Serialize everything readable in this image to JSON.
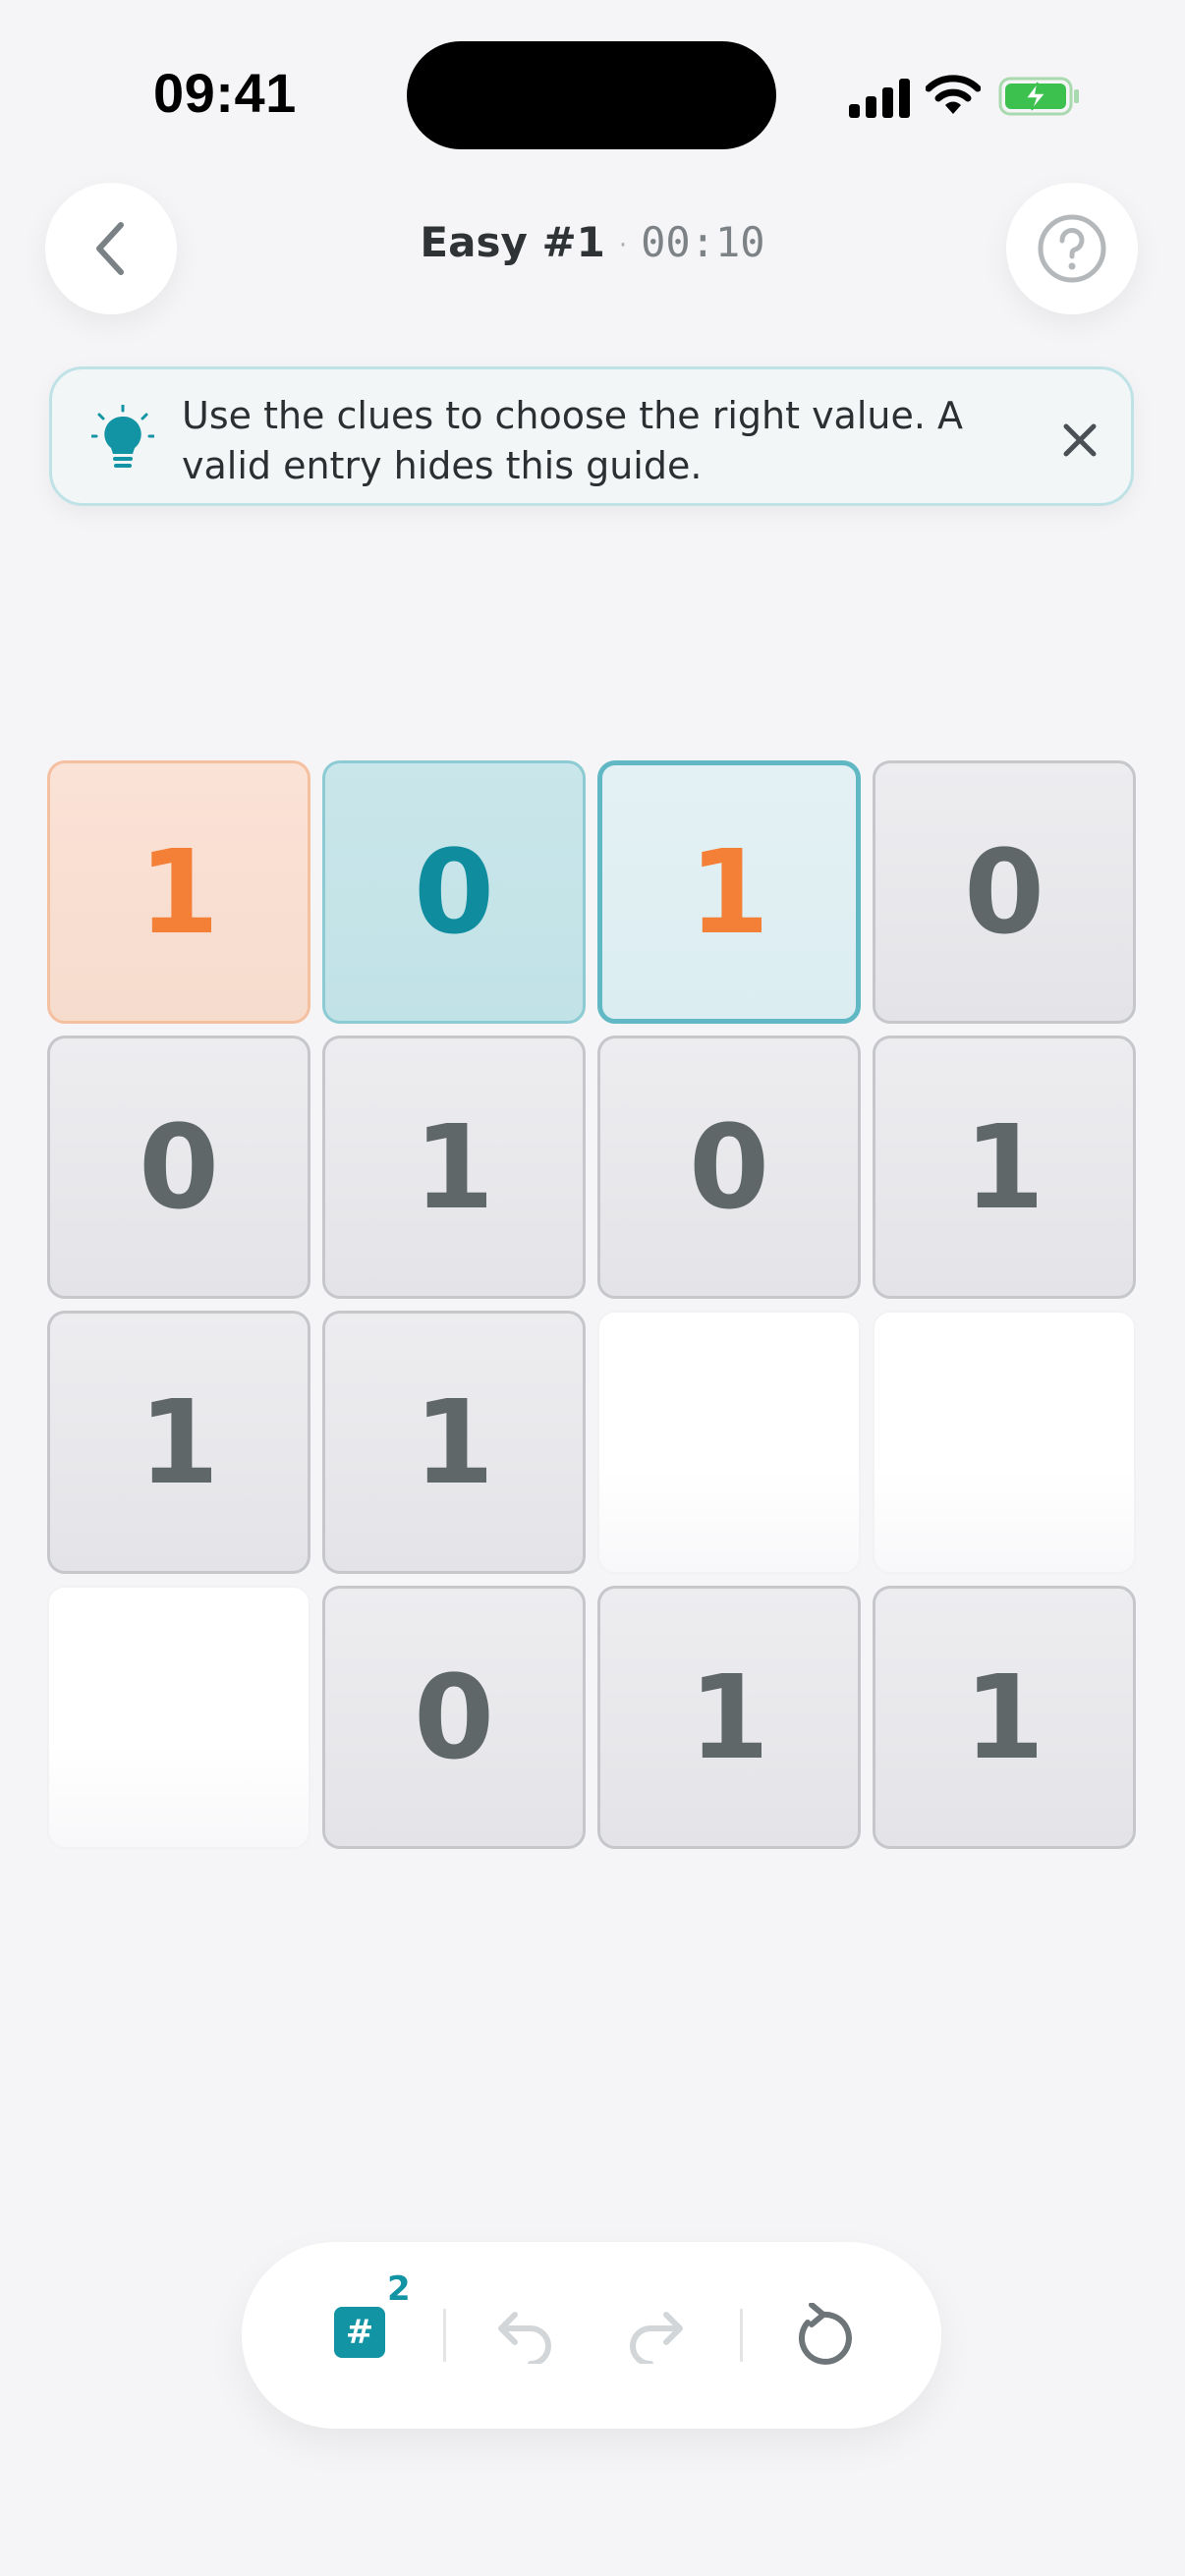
{
  "status_bar": {
    "time": "09:41",
    "icons": [
      "signal-icon",
      "wifi-icon",
      "battery-charging-icon"
    ]
  },
  "header": {
    "title": "Easy #1",
    "separator": "·",
    "timer": "00:10",
    "back_icon": "chevron-left-icon",
    "help_icon": "question-circle-icon"
  },
  "guide": {
    "icon": "lightbulb-icon",
    "text": "Use the clues to choose the right value. A valid entry hides this guide.",
    "close_icon": "close-icon"
  },
  "grid": {
    "rows": [
      [
        {
          "value": "1",
          "state": "hl-orange"
        },
        {
          "value": "0",
          "state": "hl-teal"
        },
        {
          "value": "1",
          "state": "selected"
        },
        {
          "value": "0",
          "state": "given"
        }
      ],
      [
        {
          "value": "0",
          "state": "given"
        },
        {
          "value": "1",
          "state": "given"
        },
        {
          "value": "0",
          "state": "given"
        },
        {
          "value": "1",
          "state": "given"
        }
      ],
      [
        {
          "value": "1",
          "state": "given"
        },
        {
          "value": "1",
          "state": "given"
        },
        {
          "value": "",
          "state": "empty"
        },
        {
          "value": "",
          "state": "empty"
        }
      ],
      [
        {
          "value": "",
          "state": "empty"
        },
        {
          "value": "0",
          "state": "given"
        },
        {
          "value": "1",
          "state": "given"
        },
        {
          "value": "1",
          "state": "given"
        }
      ]
    ]
  },
  "toolbar": {
    "hint_symbol": "#",
    "hint_count": "2",
    "undo_icon": "undo-icon",
    "redo_icon": "redo-icon",
    "reset_icon": "reset-icon"
  },
  "colors": {
    "accent_teal": "#1294a4",
    "accent_orange": "#f47f36",
    "given_text": "#5f6769",
    "background": "#f5f5f7"
  }
}
